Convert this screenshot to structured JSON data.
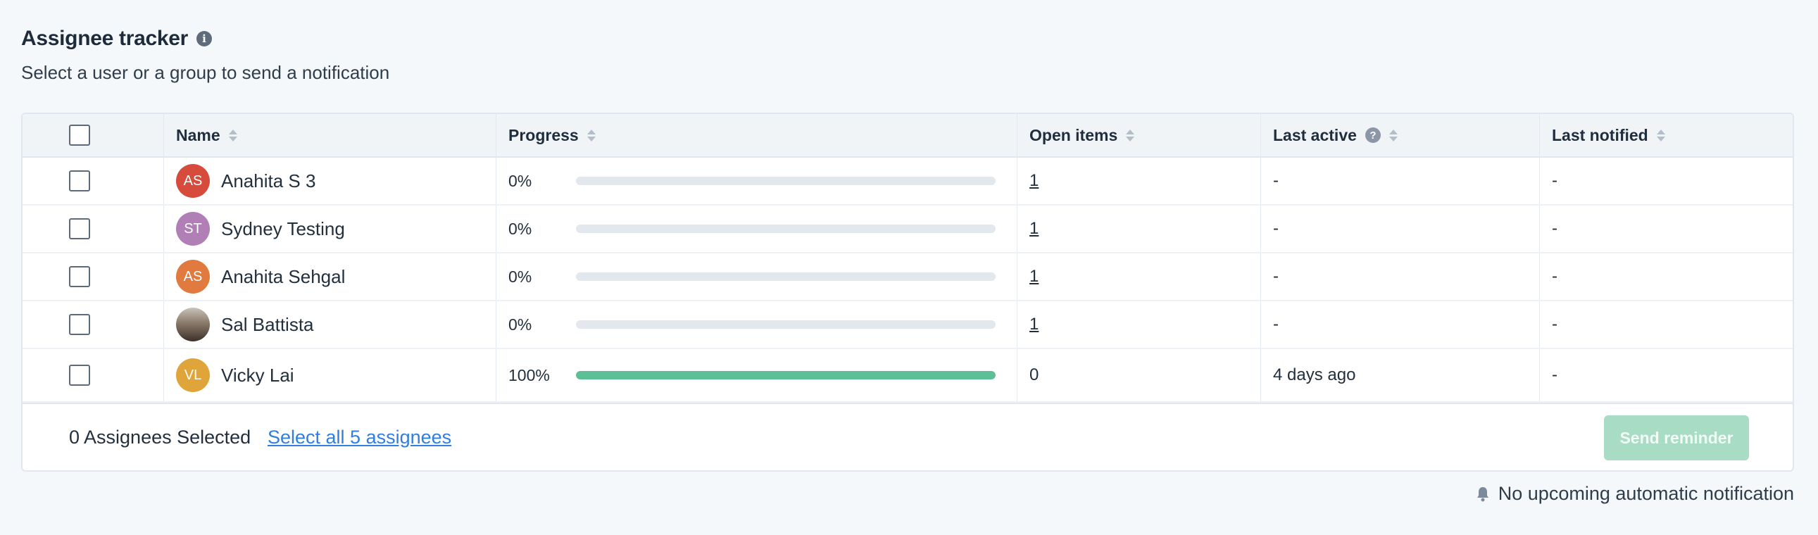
{
  "header": {
    "title": "Assignee tracker",
    "subtitle": "Select a user or a group to send a notification"
  },
  "table": {
    "columns": {
      "name": "Name",
      "progress": "Progress",
      "open_items": "Open items",
      "last_active": "Last active",
      "last_notified": "Last notified"
    },
    "rows": [
      {
        "initials": "AS",
        "avatar_color": "#d64b3c",
        "name": "Anahita S 3",
        "progress_label": "0%",
        "progress": 0,
        "open_items": "1",
        "last_active": "-",
        "last_notified": "-"
      },
      {
        "initials": "ST",
        "avatar_color": "#b07fb5",
        "name": "Sydney Testing",
        "progress_label": "0%",
        "progress": 0,
        "open_items": "1",
        "last_active": "-",
        "last_notified": "-"
      },
      {
        "initials": "AS",
        "avatar_color": "#e07a3f",
        "name": "Anahita Sehgal",
        "progress_label": "0%",
        "progress": 0,
        "open_items": "1",
        "last_active": "-",
        "last_notified": "-"
      },
      {
        "initials": "",
        "avatar_color": "#6b5a4a",
        "name": "Sal Battista",
        "progress_label": "0%",
        "progress": 0,
        "open_items": "1",
        "last_active": "-",
        "last_notified": "-"
      },
      {
        "initials": "VL",
        "avatar_color": "#e0a53a",
        "name": "Vicky Lai",
        "progress_label": "100%",
        "progress": 100,
        "open_items": "0",
        "last_active": "4 days ago",
        "last_notified": "-"
      }
    ]
  },
  "footer": {
    "selected_count": "0 Assignees Selected",
    "select_all": "Select all 5 assignees",
    "send_reminder": "Send reminder"
  },
  "auto_notification": "No upcoming automatic notification",
  "colors": {
    "progress_fill": "#5dbf95",
    "link": "#2f7fe0",
    "button_disabled": "#a9dcc5"
  }
}
